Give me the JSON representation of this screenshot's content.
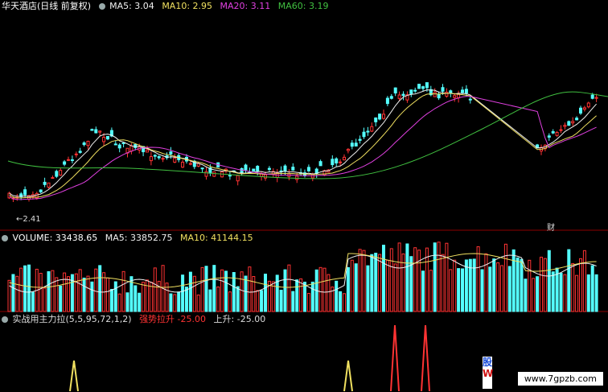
{
  "colors": {
    "up": "#ff3333",
    "down": "#54ffff",
    "ma5": "#f0f0f0",
    "ma10": "#f0e060",
    "ma20": "#e040e0",
    "ma60": "#40c040",
    "sep": "#8b0000"
  },
  "price": {
    "title": "华天酒店(日线 前复权)",
    "ma5": "MA5: 3.04",
    "ma10": "MA10: 2.95",
    "ma20": "MA20: 3.11",
    "ma60": "MA60: 3.19",
    "low_mark": "←2.41",
    "cai": "财"
  },
  "volume": {
    "title": "VOLUME: 33438.65",
    "ma5": "MA5: 33852.75",
    "ma10": "MA10: 41144.15"
  },
  "indicator": {
    "title": "实战用主力拉(5,5,95,72,1,2)",
    "trend": "强势拉升 -25.00",
    "rise": "上升: -25.00"
  },
  "watermark": {
    "site": "www.7gpzb.com",
    "side_top": "股",
    "side_bottom": "W"
  },
  "icons": [
    "settings-dot-icon"
  ]
}
